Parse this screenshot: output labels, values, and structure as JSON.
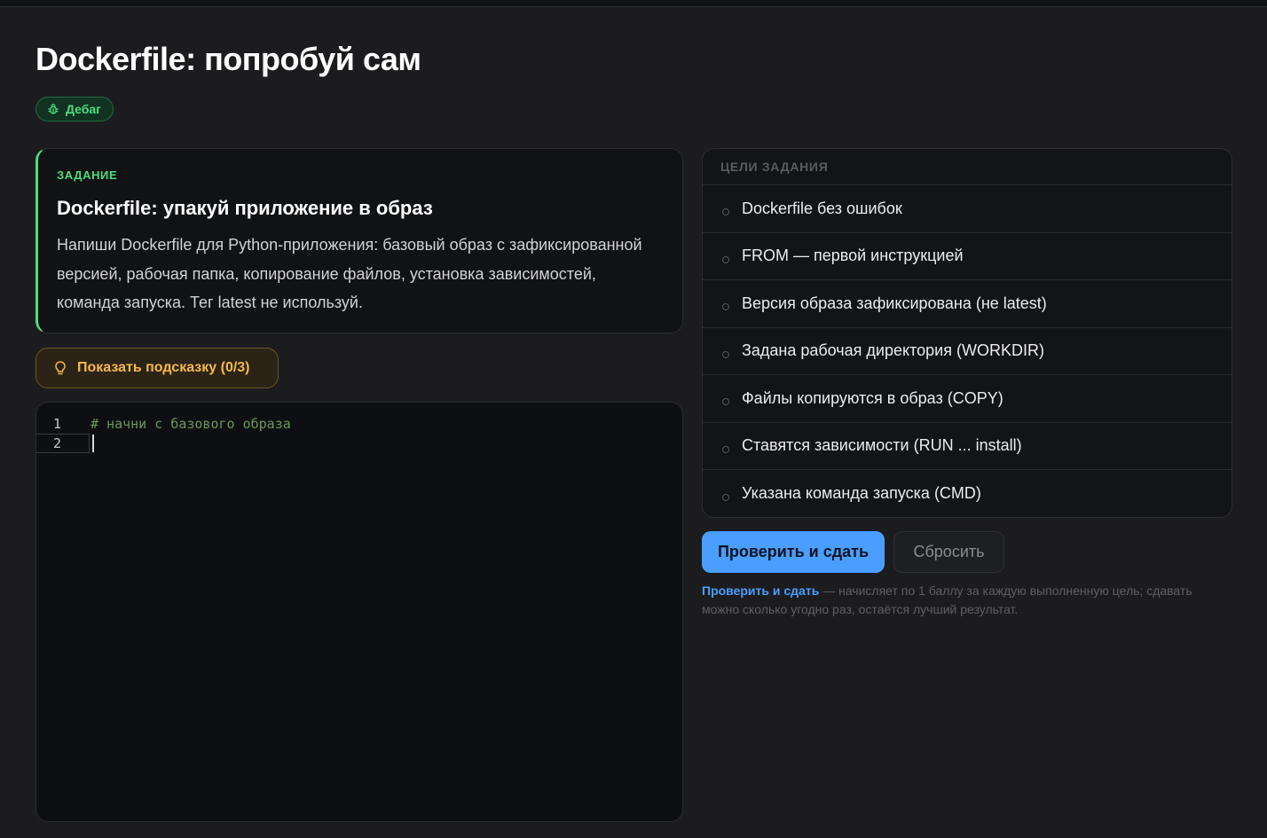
{
  "page": {
    "title": "Dockerfile: попробуй сам",
    "badge": {
      "icon": "bug-icon",
      "label": "Дебаг"
    }
  },
  "task": {
    "label": "ЗАДАНИЕ",
    "title": "Dockerfile: упакуй приложение в образ",
    "description": "Напиши Dockerfile для Python-приложения: базовый образ с зафиксированной версией, рабочая папка, копирование файлов, установка зависимостей, команда запуска. Тег latest не используй."
  },
  "hint": {
    "icon": "lightbulb-icon",
    "label": "Показать подсказку (0/3)"
  },
  "editor": {
    "lines": [
      {
        "number": "1",
        "text": "# начни с базового образа"
      },
      {
        "number": "2",
        "text": ""
      }
    ]
  },
  "goals": {
    "header": "ЦЕЛИ ЗАДАНИЯ",
    "items": [
      "Dockerfile без ошибок",
      "FROM — первой инструкцией",
      "Версия образа зафиксирована (не latest)",
      "Задана рабочая директория (WORKDIR)",
      "Файлы копируются в образ (COPY)",
      "Ставятся зависимости (RUN ... install)",
      "Указана команда запуска (CMD)"
    ]
  },
  "actions": {
    "submit_label": "Проверить и сдать",
    "reset_label": "Сбросить"
  },
  "note": {
    "strong": "Проверить и сдать",
    "text": " — начисляет по 1 баллу за каждую выполненную цель; сдавать можно сколько угодно раз, остаётся лучший результат."
  },
  "colors": {
    "accent_green": "#4ade80",
    "accent_blue": "#4a9eff",
    "hint_amber": "#f5b94a",
    "comment_green": "#6a9955"
  }
}
